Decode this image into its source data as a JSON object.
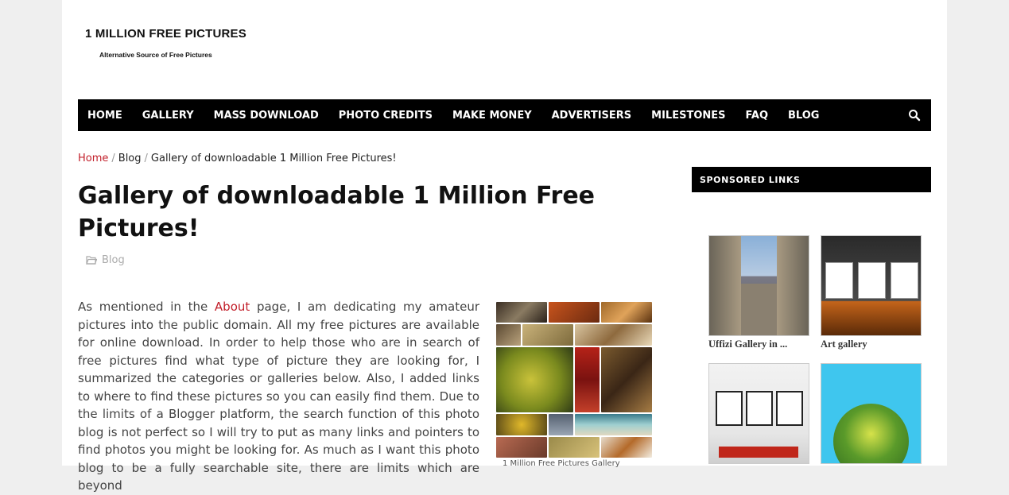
{
  "site": {
    "title": "1 MILLION FREE PICTURES",
    "tagline": "Alternative Source of Free Pictures"
  },
  "nav": {
    "items": [
      "HOME",
      "GALLERY",
      "MASS DOWNLOAD",
      "PHOTO CREDITS",
      "MAKE MONEY",
      "ADVERTISERS",
      "MILESTONES",
      "FAQ",
      "BLOG"
    ],
    "search_icon": "search-icon"
  },
  "breadcrumb": {
    "home": "Home",
    "blog": "Blog",
    "current": "Gallery of downloadable 1 Million Free Pictures!"
  },
  "post": {
    "title": "Gallery of downloadable 1 Million Free Pictures!",
    "category": "Blog",
    "body_before_link": "As mentioned in the ",
    "body_link": "About",
    "body_after_link": " page, I am dedicating my amateur pictures into the public domain.  All my free pictures are available for online download.  In order to help those who are in search of free pictures find what type of picture they are looking for, I summarized the categories or galleries below.  Also, I added links to where to find these pictures so you can easily find them.  Due to the limits of a Blogger platform, the search function of this photo blog is not perfect so I will try to put as many links and pointers to find photos you might be looking for.  As much as I want this photo blog to be a fully searchable site, there are limits which are beyond",
    "image_caption": "1 Million Free Pictures Gallery"
  },
  "sidebar": {
    "heading": "SPONSORED LINKS",
    "ads": [
      {
        "label": "Uffizi Gallery in ..."
      },
      {
        "label": "Art gallery"
      },
      {
        "label": ""
      },
      {
        "label": ""
      }
    ]
  },
  "colors": {
    "accent": "#c21f2a",
    "nav_bg": "#000000",
    "page_bg": "#efefef"
  }
}
